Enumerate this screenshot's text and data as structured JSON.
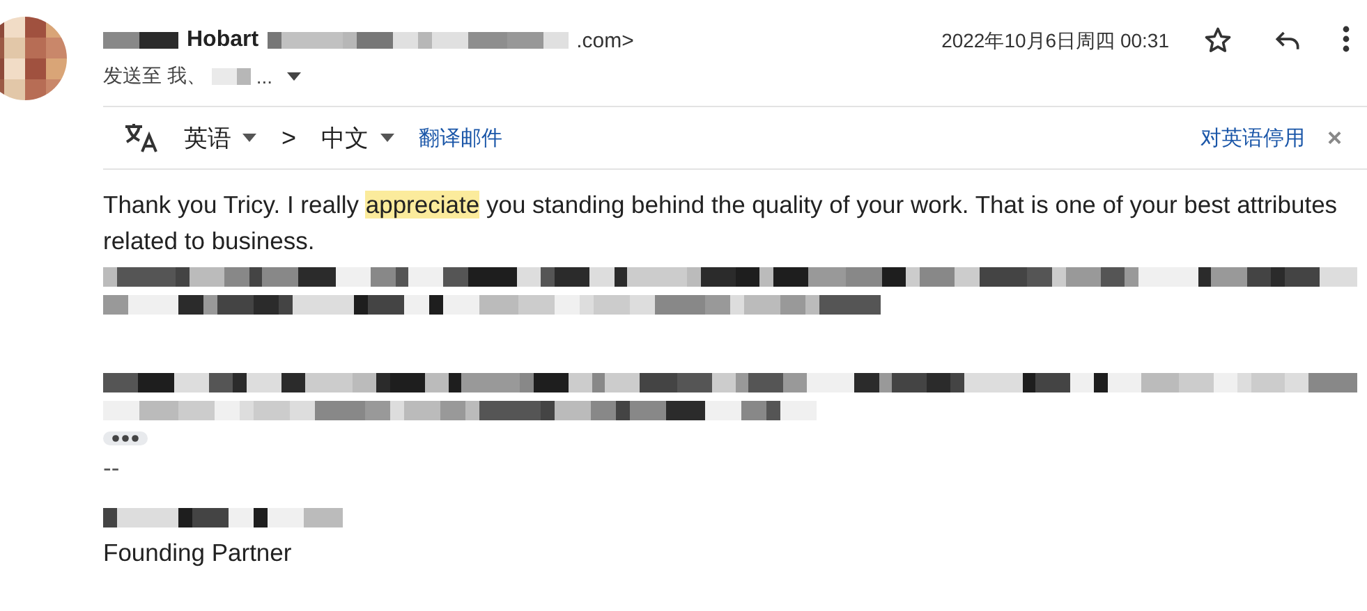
{
  "header": {
    "sender_name": "Hobart",
    "sender_email_tail": ".com>",
    "recipients": "发送至 我、",
    "recipients_more": "...",
    "date": "2022年10月6日周四 00:31"
  },
  "translate_bar": {
    "source_language": "英语",
    "arrow": ">",
    "target_language": "中文",
    "translate_link": "翻译邮件",
    "disable_link": "对英语停用",
    "close": "×"
  },
  "body": {
    "segments": [
      {
        "text": "Thank you Tricy. I really ",
        "highlighted": false
      },
      {
        "text": "appreciate",
        "highlighted": true
      },
      {
        "text": " you standing behind the quality of your work. That is one of your best attributes related to business.",
        "highlighted": false
      }
    ],
    "separator": "--",
    "signature_title": "Founding Partner"
  }
}
